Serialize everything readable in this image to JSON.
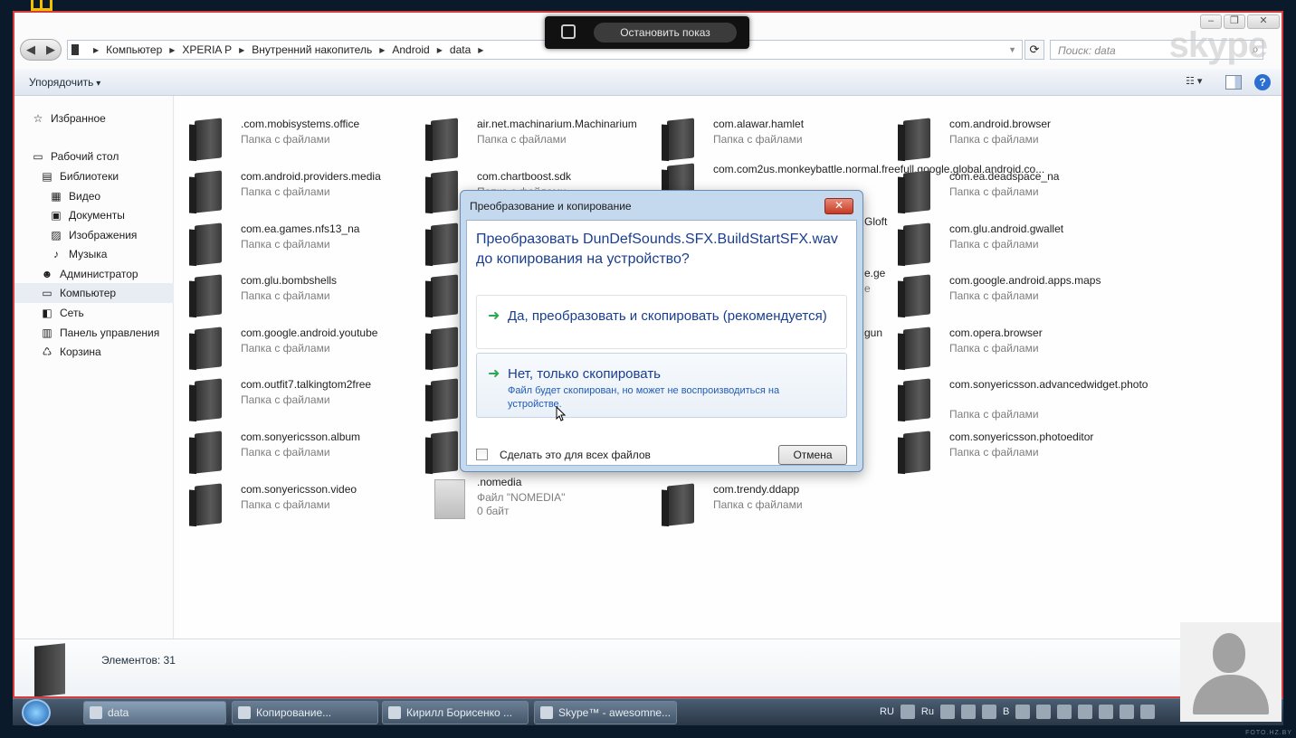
{
  "window": {
    "address": [
      "Компьютер",
      "XPERIA P",
      "Внутренний накопитель",
      "Android",
      "data"
    ],
    "search_placeholder": "Поиск: data",
    "watermark": "skype",
    "toolbar": {
      "organize": "Упорядочить"
    }
  },
  "sidebar": {
    "items": [
      {
        "label": "Избранное",
        "icon": "star-icon"
      },
      {
        "label": "Рабочий стол",
        "icon": "desktop-icon"
      },
      {
        "label": "Библиотеки",
        "icon": "library-icon"
      },
      {
        "label": "Видео",
        "icon": "video-icon"
      },
      {
        "label": "Документы",
        "icon": "documents-icon"
      },
      {
        "label": "Изображения",
        "icon": "pictures-icon"
      },
      {
        "label": "Музыка",
        "icon": "music-icon"
      },
      {
        "label": "Администратор",
        "icon": "user-icon"
      },
      {
        "label": "Компьютер",
        "icon": "computer-icon",
        "selected": true
      },
      {
        "label": "Сеть",
        "icon": "network-icon"
      },
      {
        "label": "Панель управления",
        "icon": "control-panel-icon"
      },
      {
        "label": "Корзина",
        "icon": "recycle-bin-icon"
      }
    ]
  },
  "files": [
    {
      "name": ".com.mobisystems.office",
      "type": "Папка с файлами"
    },
    {
      "name": "air.net.machinarium.Machinarium",
      "type": "Папка с файлами"
    },
    {
      "name": "com.alawar.hamlet",
      "type": "Папка с файлами"
    },
    {
      "name": "com.android.browser",
      "type": "Папка с файлами"
    },
    {
      "name": "com.android.providers.media",
      "type": "Папка с файлами"
    },
    {
      "name": "com.chartboost.sdk",
      "type": "Папка с файлами"
    },
    {
      "name": "com.com2us.monkeybattle.normal.freefull.google.global.android.co...",
      "type": ""
    },
    {
      "name": "com.ea.deadspace_na",
      "type": "Папка с файлами"
    },
    {
      "name": "com.ea.games.nfs13_na",
      "type": "Папка с файлами"
    },
    {
      "name": "com.glu.android.gwallet",
      "type": "Папка с файлами"
    },
    {
      "name": "com.glu.bombshells",
      "type": "Папка с файлами"
    },
    {
      "name": "com.google.android.apps.maps",
      "type": "Папка с файлами"
    },
    {
      "name": "com.google.android.youtube",
      "type": "Папка с файлами"
    },
    {
      "name": "com.opera.browser",
      "type": "Папка с файлами"
    },
    {
      "name": "com.outfit7.talkingtom2free",
      "type": "Папка с файлами"
    },
    {
      "name": "com.sonyericsson.advancedwidget.photo",
      "type": "Папка с файлами"
    },
    {
      "name": "com.sonyericsson.album",
      "type": "Папка с файлами"
    },
    {
      "name": "com.sonyericsson.photoeditor",
      "type": "Папка с файлами"
    },
    {
      "name": "com.sonyericsson.video",
      "type": "Папка с файлами"
    },
    {
      "name": ".nomedia",
      "type": "Файл \"NOMEDIA\"",
      "size": "0 байт"
    },
    {
      "name": "com.trendy.ddapp",
      "type": "Папка с файлами"
    }
  ],
  "partial_names": [
    "Gloft",
    "e.ge",
    "e",
    "gun"
  ],
  "details": {
    "count": "Элементов: 31"
  },
  "screenshare": {
    "stop": "Остановить показ"
  },
  "dialog": {
    "title": "Преобразование и копирование",
    "close": "✕",
    "question": "Преобразовать DunDefSounds.SFX.BuildStartSFX.wav до копирования на устройство?",
    "option1": "Да, преобразовать и скопировать (рекомендуется)",
    "option2": "Нет, только скопировать",
    "option2_note": "Файл будет скопирован, но может не воспроизводиться на устройстве.",
    "apply_all": "Сделать это для всех файлов",
    "cancel": "Отмена"
  },
  "taskbar": {
    "buttons": [
      "data",
      "Копирование...",
      "Кирилл Борисенко ...",
      "Skype™ - awesomne..."
    ],
    "lang": "RU",
    "tray_lang": "Ru",
    "tray_b": "B"
  },
  "watermark_footer": "FOTO.HZ.BY"
}
